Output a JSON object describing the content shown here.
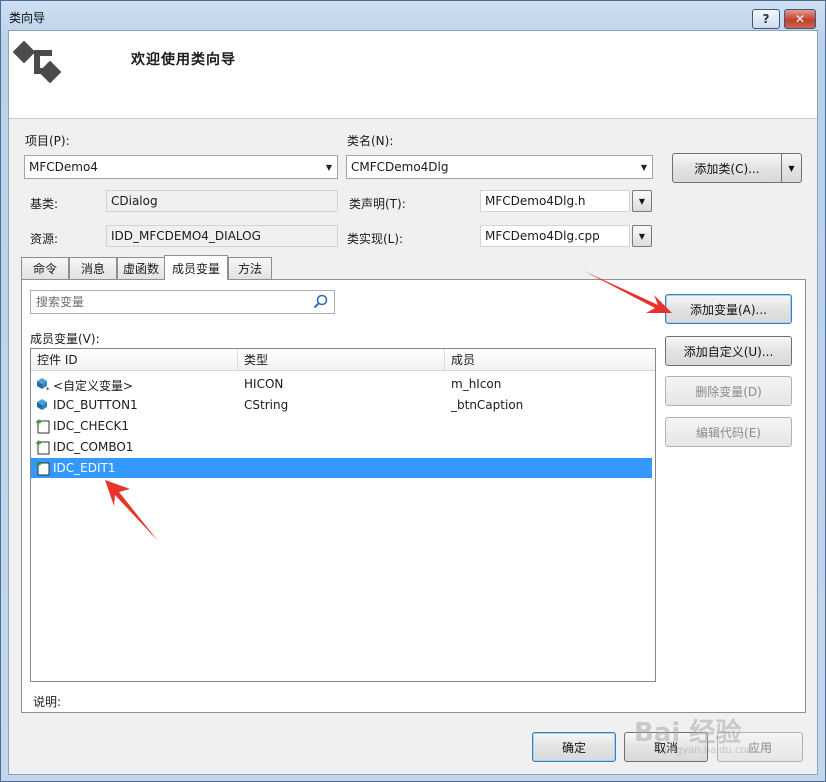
{
  "window": {
    "title": "类向导",
    "help_glyph": "?",
    "close_glyph": "✕",
    "header_title": "欢迎使用类向导"
  },
  "form": {
    "project_label": "项目(P):",
    "project_value": "MFCDemo4",
    "class_name_label": "类名(N):",
    "class_name_value": "CMFCDemo4Dlg",
    "add_class_button": "添加类(C)...",
    "base_class_label": "基类:",
    "base_class_value": "CDialog",
    "class_decl_label": "类声明(T):",
    "class_decl_value": "MFCDemo4Dlg.h",
    "resource_label": "资源:",
    "resource_value": "IDD_MFCDEMO4_DIALOG",
    "class_impl_label": "类实现(L):",
    "class_impl_value": "MFCDemo4Dlg.cpp"
  },
  "tabs": [
    {
      "label": "命令"
    },
    {
      "label": "消息"
    },
    {
      "label": "虚函数"
    },
    {
      "label": "成员变量",
      "active": true
    },
    {
      "label": "方法"
    }
  ],
  "members": {
    "search_placeholder": "搜索变量",
    "list_label": "成员变量(V):",
    "columns": [
      "控件 ID",
      "类型",
      "成员"
    ],
    "rows": [
      {
        "id": "<自定义变量>",
        "type": "HICON",
        "member": "m_hIcon",
        "icon": "custom-variable-icon"
      },
      {
        "id": "IDC_BUTTON1",
        "type": "CString",
        "member": "_btnCaption",
        "icon": "variable-icon"
      },
      {
        "id": "IDC_CHECK1",
        "type": "",
        "member": "",
        "icon": "control-icon"
      },
      {
        "id": "IDC_COMBO1",
        "type": "",
        "member": "",
        "icon": "control-icon"
      },
      {
        "id": "IDC_EDIT1",
        "type": "",
        "member": "",
        "icon": "control-icon",
        "selected": true
      }
    ],
    "add_variable_button": "添加变量(A)...",
    "add_custom_button": "添加自定义(U)...",
    "delete_variable_button": "删除变量(D)",
    "edit_code_button": "编辑代码(E)",
    "description_label": "说明:"
  },
  "footer": {
    "ok_button": "确定",
    "cancel_button": "取消",
    "apply_button": "应用"
  },
  "watermark": {
    "text": "Bai  经验",
    "sub": "jingyan.baidu.com"
  },
  "colors": {
    "selection": "#3399ff",
    "annotation_arrow": "#e8322b"
  }
}
